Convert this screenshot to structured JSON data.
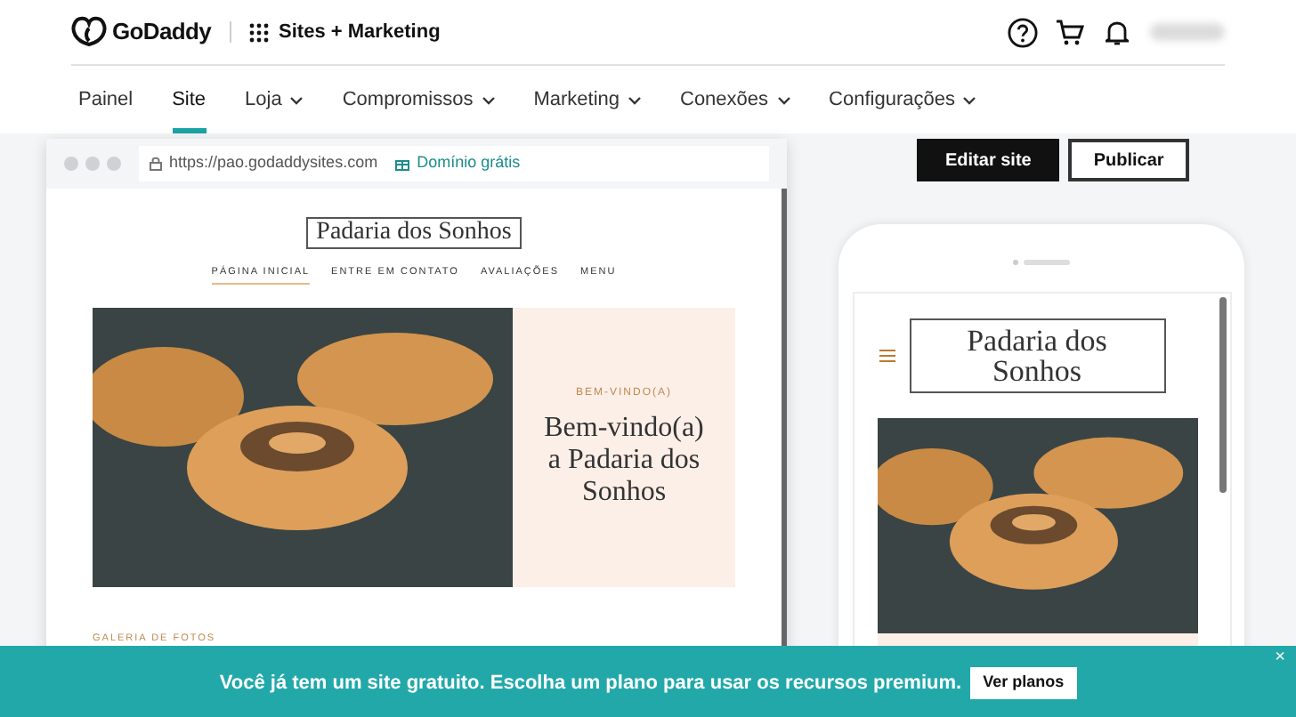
{
  "header": {
    "logo": "GoDaddy",
    "product": "Sites + Marketing"
  },
  "nav": [
    {
      "label": "Painel",
      "selected": false,
      "has_menu": false
    },
    {
      "label": "Site",
      "selected": true,
      "has_menu": false
    },
    {
      "label": "Loja",
      "selected": false,
      "has_menu": true
    },
    {
      "label": "Compromissos",
      "selected": false,
      "has_menu": true
    },
    {
      "label": "Marketing",
      "selected": false,
      "has_menu": true
    },
    {
      "label": "Conexões",
      "selected": false,
      "has_menu": true
    },
    {
      "label": "Configurações",
      "selected": false,
      "has_menu": true
    }
  ],
  "actions": [
    {
      "label": "Editar site",
      "kind": "primary"
    },
    {
      "label": "Publicar",
      "kind": "secondary"
    }
  ],
  "desktop_preview": {
    "url": "https://pao.godaddysites.com",
    "domain_badge": "Domínio grátis",
    "site": {
      "title": "Padaria dos Sonhos",
      "nav": [
        {
          "label": "PÁGINA INICIAL",
          "selected": true
        },
        {
          "label": "ENTRE EM CONTATO",
          "selected": false
        },
        {
          "label": "AVALIAÇÕES",
          "selected": false
        },
        {
          "label": "MENU",
          "selected": false
        }
      ],
      "hero": {
        "eyebrow": "BEM-VINDO(A)",
        "heading": "Bem-vindo(a) a Padaria dos Sonhos"
      },
      "gallery_label": "GALERIA DE FOTOS"
    }
  },
  "mobile_preview": {
    "title": "Padaria dos Sonhos"
  },
  "banner": {
    "message": "Você já tem um site gratuito. Escolha um plano para usar os recursos premium.",
    "button": "Ver planos",
    "close": "×"
  }
}
